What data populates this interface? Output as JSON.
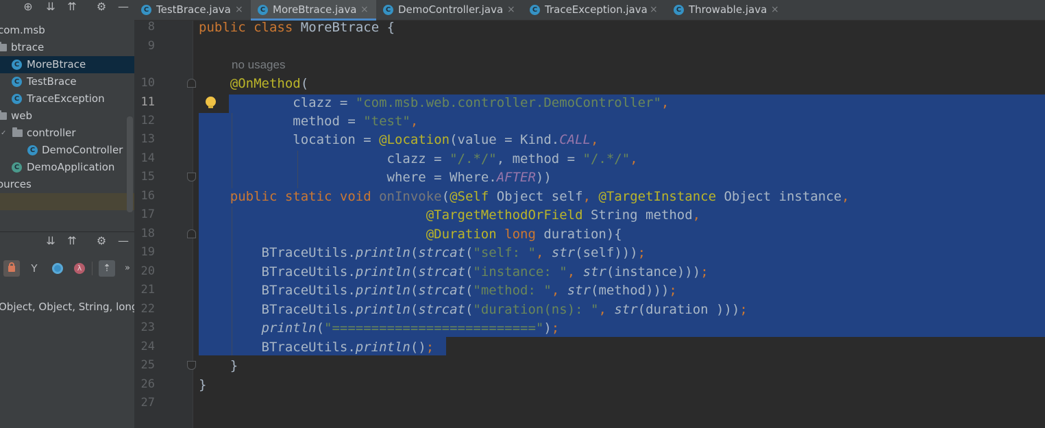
{
  "colors": {
    "accent": "#4a88c7",
    "selection": "#214283",
    "keyword": "#cc7832",
    "annotation": "#bbb529",
    "string": "#6a8759",
    "constant": "#9876aa"
  },
  "tabs": [
    {
      "label": "TestBrace.java",
      "active": false,
      "icon": "class-icon"
    },
    {
      "label": "MoreBtrace.java",
      "active": true,
      "icon": "class-icon"
    },
    {
      "label": "DemoController.java",
      "active": false,
      "icon": "class-icon"
    },
    {
      "label": "TraceException.java",
      "active": false,
      "icon": "class-icon"
    },
    {
      "label": "Throwable.java",
      "active": false,
      "icon": "class-icon"
    }
  ],
  "close_glyph": "×",
  "project_tree": [
    {
      "label": "com.msb",
      "icon": ""
    },
    {
      "label": "btrace",
      "icon": "folder-icon"
    },
    {
      "label": "MoreBtrace",
      "icon": "class-icon",
      "selected": true
    },
    {
      "label": "TestBrace",
      "icon": "class-icon"
    },
    {
      "label": "TraceException",
      "icon": "class-icon"
    },
    {
      "label": "web",
      "icon": "folder-icon"
    },
    {
      "label": "controller",
      "icon": "folder-icon"
    },
    {
      "label": "DemoController",
      "icon": "class-icon"
    },
    {
      "label": "DemoApplication",
      "icon": "spring-class-icon"
    },
    {
      "label": "ources",
      "icon": ""
    }
  ],
  "structure": {
    "signature": "Object, Object, String, long"
  },
  "editor": {
    "current_line": 11,
    "inlay_hint": "no usages",
    "line_numbers": [
      "8",
      "9",
      "10",
      "11",
      "12",
      "13",
      "14",
      "15",
      "16",
      "17",
      "18",
      "19",
      "20",
      "21",
      "22",
      "23",
      "24",
      "25",
      "26",
      "27"
    ],
    "code": {
      "l8": {
        "kw1": "public",
        "kw2": "class",
        "name": "MoreBtrace {"
      },
      "l10": {
        "ann": "@OnMethod",
        "rest": "("
      },
      "l11": {
        "a": "clazz = ",
        "s": "\"com.msb.web.controller.DemoController\"",
        "c": ","
      },
      "l12": {
        "a": "method = ",
        "s": "\"test\"",
        "c": ","
      },
      "l13": {
        "a": "location = ",
        "ann": "@Location",
        "b": "(value = Kind.",
        "const": "CALL",
        "c": ","
      },
      "l14": {
        "a": "clazz = ",
        "s1": "\"/.*/\"",
        "b": ", method = ",
        "s2": "\"/.*/\"",
        "c": ","
      },
      "l15": {
        "a": "where = Where.",
        "const": "AFTER",
        "b": "))"
      },
      "l16": {
        "kw": "public static void ",
        "m": "onInvoke",
        "p": "(",
        "a1": "@Self",
        "t1": " Object self",
        "c1": ", ",
        "a2": "@TargetInstance",
        "t2": " Object instance",
        "c2": ","
      },
      "l17": {
        "a": "@TargetMethodOrField",
        "t": " String method",
        "c": ","
      },
      "l18": {
        "a": "@Duration",
        "kw": " long",
        "t": " duration){"
      },
      "l19": {
        "a": "BTraceUtils.",
        "f": "println",
        "p1": "(",
        "g": "strcat",
        "p2": "(",
        "s": "\"self: \"",
        "b": ", ",
        "h": "str",
        "e": "(self)))",
        "sc": ";"
      },
      "l20": {
        "a": "BTraceUtils.",
        "f": "println",
        "p1": "(",
        "g": "strcat",
        "p2": "(",
        "s": "\"instance: \"",
        "b": ", ",
        "h": "str",
        "e": "(instance)))",
        "sc": ";"
      },
      "l21": {
        "a": "BTraceUtils.",
        "f": "println",
        "p1": "(",
        "g": "strcat",
        "p2": "(",
        "s": "\"method: \"",
        "b": ", ",
        "h": "str",
        "e": "(method)))",
        "sc": ";"
      },
      "l22": {
        "a": "BTraceUtils.",
        "f": "println",
        "p1": "(",
        "g": "strcat",
        "p2": "(",
        "s": "\"duration(ns): \"",
        "b": ", ",
        "h": "str",
        "e": "(duration )))",
        "sc": ";"
      },
      "l23": {
        "f": "println",
        "p1": "(",
        "s": "\"==========================\"",
        "e": ")",
        "sc": ";"
      },
      "l24": {
        "a": "BTraceUtils.",
        "f": "println",
        "e": "()",
        "sc": ";"
      },
      "l25": "}",
      "l26": "}"
    }
  }
}
